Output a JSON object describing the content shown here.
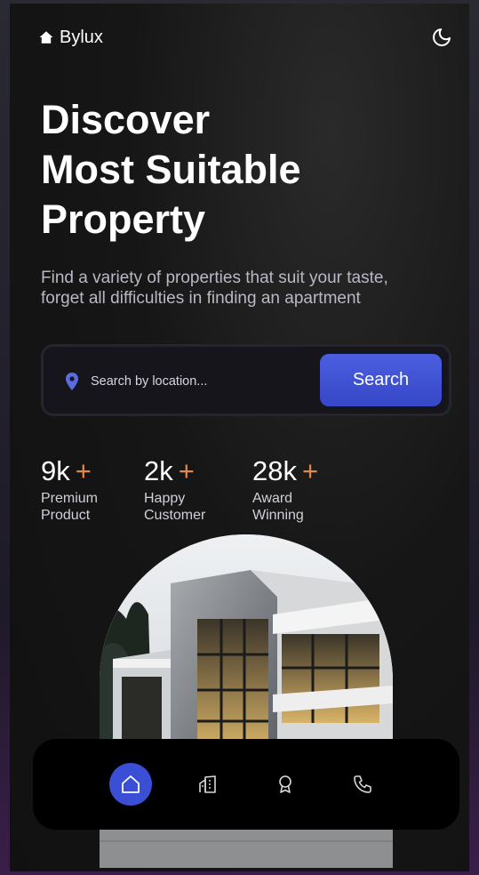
{
  "header": {
    "brand": "Bylux",
    "logo_icon": "home-icon",
    "theme_icon": "moon-icon"
  },
  "hero": {
    "title_lines": [
      "Discover",
      "Most Suitable",
      "Property"
    ],
    "subtitle": "Find a variety of properties that suit your taste, forget all difficulties in finding an apartment"
  },
  "search": {
    "placeholder": "Search by location...",
    "button_label": "Search",
    "icon": "location-pin-icon"
  },
  "stats": [
    {
      "value": "9k",
      "plus": "+",
      "label": "Premium Product"
    },
    {
      "value": "2k",
      "plus": "+",
      "label": "Happy Customer"
    },
    {
      "value": "28k",
      "plus": "+",
      "label": "Award Winning"
    }
  ],
  "nav": {
    "items": [
      {
        "icon": "home-icon",
        "active": true
      },
      {
        "icon": "building-icon",
        "active": false
      },
      {
        "icon": "award-icon",
        "active": false
      },
      {
        "icon": "phone-icon",
        "active": false
      }
    ]
  },
  "colors": {
    "accent": "#3b4fd6",
    "plus": "#e0874a",
    "background": "#111111"
  }
}
